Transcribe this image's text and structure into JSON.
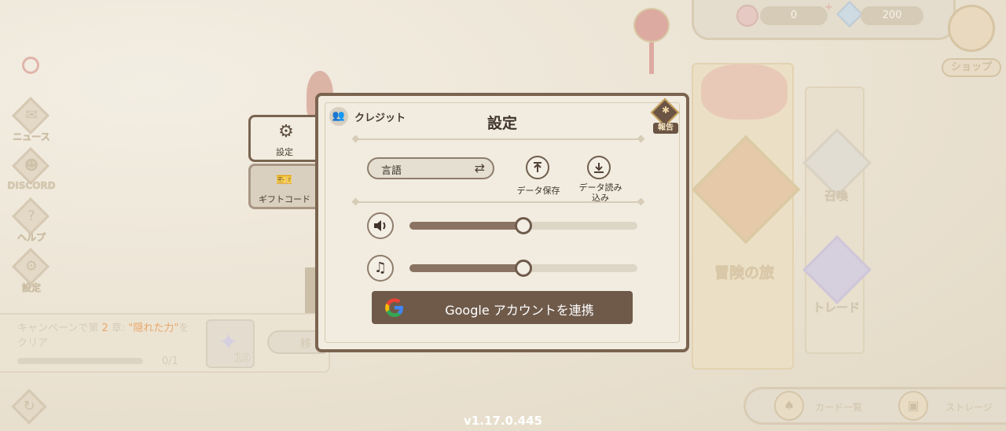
{
  "left_nav": [
    {
      "label": "ニュース",
      "icon": "news-icon"
    },
    {
      "label": "DISCORD",
      "icon": "discord-icon"
    },
    {
      "label": "ヘルプ",
      "icon": "help-icon"
    },
    {
      "label": "設定",
      "icon": "settings-icon"
    }
  ],
  "topbar": {
    "currency1": "0",
    "currency2": "200",
    "shop_label": "ショップ"
  },
  "tabs": {
    "settings_label": "設定",
    "giftcode_label": "ギフトコード"
  },
  "dialog": {
    "title": "設定",
    "credits_label": "クレジット",
    "report_label": "報告",
    "language_label": "言語",
    "save_data_label": "データ保存",
    "load_data_label": "データ読み込み",
    "sound_volume": 0.5,
    "music_volume": 0.5,
    "google_button_label": "Google アカウントを連携"
  },
  "quest": {
    "prefix": "キャンペーンで第 ",
    "chapter": "2",
    "middle": " 章: ",
    "name": "\"隠れた力\"",
    "suffix": "をクリア",
    "progress": "0/1",
    "progress_value": 0,
    "reward_count": "10",
    "move_label": "移"
  },
  "right_panels": {
    "adventure_label": "冒険の旅",
    "summon_label": "召喚",
    "trade_label": "トレード"
  },
  "bottom_bar": {
    "card_list_label": "カード一覧",
    "storage_label": "ストレージ"
  },
  "version": "v1.17.0.445",
  "colors": {
    "accent_brown": "#7a6450",
    "button_brown": "#6f5a4a",
    "quest_orange": "#e8a66a"
  }
}
